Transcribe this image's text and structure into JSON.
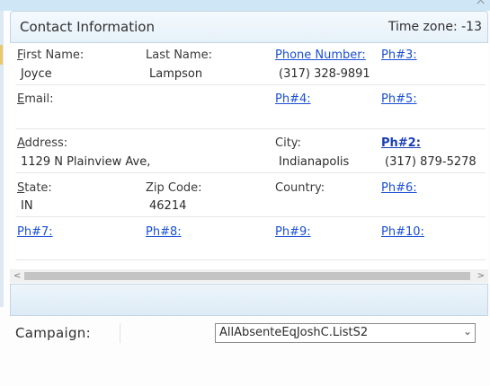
{
  "window": {
    "close_glyph": "×"
  },
  "header": {
    "title": "Contact Information",
    "timezone": "Time zone: -13"
  },
  "row1": {
    "first_name_prefix": "F",
    "first_name_rest": "irst Name:",
    "first_name_value": "Joyce",
    "last_name_label": "Last Name:",
    "last_name_value": "Lampson",
    "phone_label": "Phone Number:",
    "phone_value": "(317) 328-9891",
    "ph3_label": "Ph#3:"
  },
  "row2": {
    "email_prefix": "E",
    "email_rest": "mail:",
    "ph4_label": "Ph#4:",
    "ph5_label": "Ph#5:"
  },
  "row3": {
    "address_prefix": "A",
    "address_rest": "ddress:",
    "address_value": "1129 N Plainview Ave,",
    "city_label": "City:",
    "city_value": "Indianapolis",
    "ph2_label": "Ph#2:",
    "ph2_value": "(317) 879-5278"
  },
  "row4": {
    "state_prefix": "S",
    "state_rest": "tate:",
    "state_value": "IN",
    "zip_label": "Zip Code:",
    "zip_value": "46214",
    "country_label": "Country:",
    "ph6_label": "Ph#6:"
  },
  "row5": {
    "ph7_label": "Ph#7:",
    "ph8_label": "Ph#8:",
    "ph9_label": "Ph#9:",
    "ph10_label": "Ph#10:"
  },
  "scrollbar": {
    "left_arrow": "<",
    "right_arrow": ">"
  },
  "campaign": {
    "label": "Campaign:",
    "selected": "AllAbsenteEqJoshC.ListS2",
    "chevron": "⌄"
  }
}
